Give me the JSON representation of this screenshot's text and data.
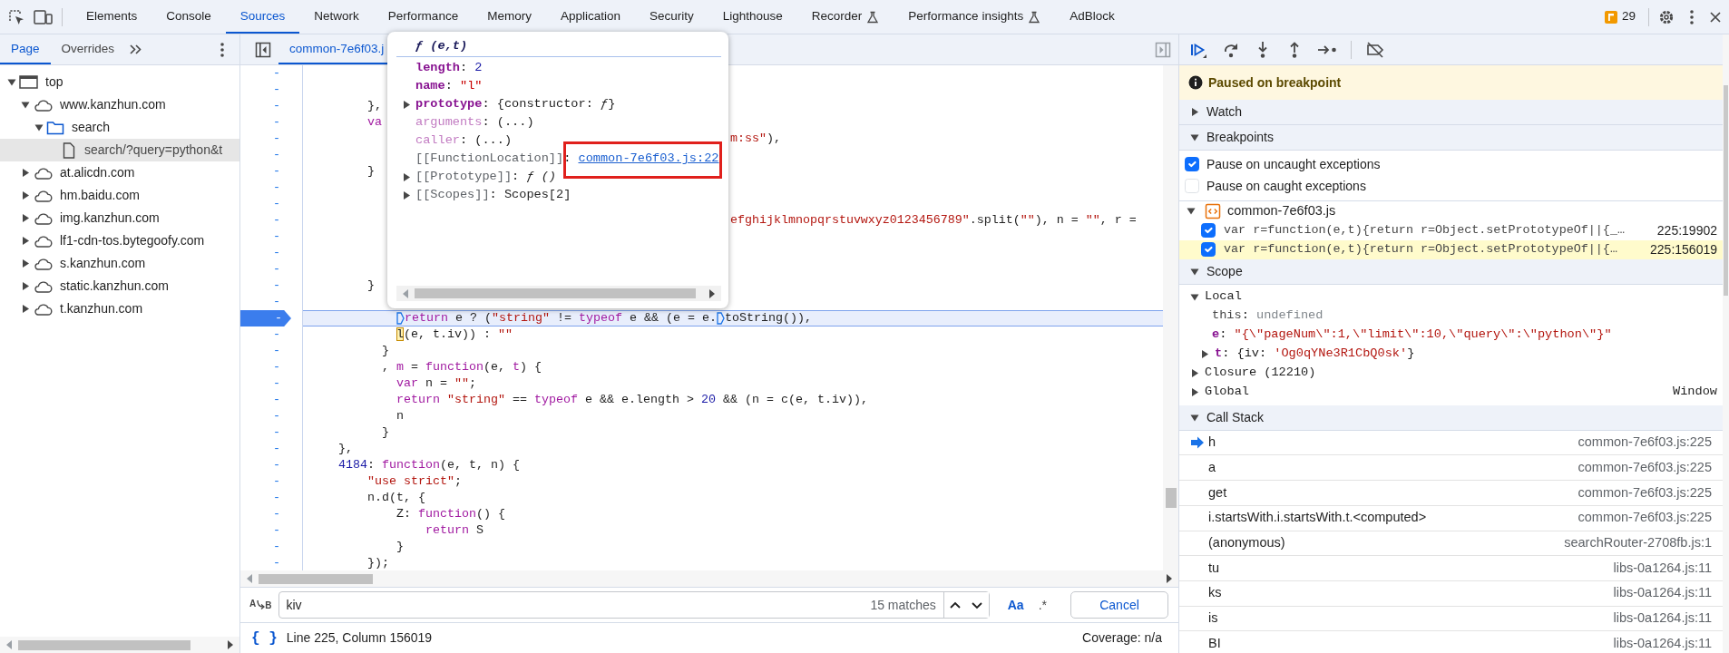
{
  "toolbar": {
    "tabs": [
      {
        "label": "Elements",
        "selected": false
      },
      {
        "label": "Console",
        "selected": false
      },
      {
        "label": "Sources",
        "selected": true
      },
      {
        "label": "Network",
        "selected": false
      },
      {
        "label": "Performance",
        "selected": false
      },
      {
        "label": "Memory",
        "selected": false
      },
      {
        "label": "Application",
        "selected": false
      },
      {
        "label": "Security",
        "selected": false
      },
      {
        "label": "Lighthouse",
        "selected": false
      },
      {
        "label": "Recorder",
        "selected": false,
        "experimental": true
      },
      {
        "label": "Performance insights",
        "selected": false,
        "experimental": true
      },
      {
        "label": "AdBlock",
        "selected": false
      }
    ],
    "issues_count": "29"
  },
  "navigator": {
    "tabs": [
      {
        "label": "Page",
        "selected": true
      },
      {
        "label": "Overrides",
        "selected": false
      }
    ],
    "tree": [
      {
        "label": "top",
        "kind": "frame",
        "expanded": true,
        "selected": false,
        "children": [
          {
            "label": "www.kanzhun.com",
            "kind": "domain",
            "expanded": true,
            "selected": false,
            "children": [
              {
                "label": "search",
                "kind": "folder",
                "expanded": true,
                "selected": false,
                "children": [
                  {
                    "label": "search/?query=python&t",
                    "kind": "file",
                    "selected": true
                  }
                ]
              }
            ]
          },
          {
            "label": "at.alicdn.com",
            "kind": "domain",
            "expanded": false,
            "selected": false
          },
          {
            "label": "hm.baidu.com",
            "kind": "domain",
            "expanded": false,
            "selected": false
          },
          {
            "label": "img.kanzhun.com",
            "kind": "domain",
            "expanded": false,
            "selected": false
          },
          {
            "label": "lf1-cdn-tos.bytegoofy.com",
            "kind": "domain",
            "expanded": false,
            "selected": false
          },
          {
            "label": "s.kanzhun.com",
            "kind": "domain",
            "expanded": false,
            "selected": false
          },
          {
            "label": "static.kanzhun.com",
            "kind": "domain",
            "expanded": false,
            "selected": false
          },
          {
            "label": "t.kanzhun.com",
            "kind": "domain",
            "expanded": false,
            "selected": false
          }
        ]
      }
    ]
  },
  "editor": {
    "tabs": [
      {
        "label": "common-7e6f03.j",
        "selected": true
      }
    ],
    "lines": [
      {
        "gutter": "-",
        "paused": false
      },
      {
        "gutter": "-",
        "paused": false
      },
      {
        "gutter": "-",
        "paused": false,
        "tokens": [
          {
            "kind": "plain",
            "text": "        },"
          }
        ]
      },
      {
        "gutter": "-",
        "paused": false,
        "tokens": [
          {
            "kind": "keyword",
            "text": "        va"
          }
        ]
      },
      {
        "gutter": "-",
        "paused": false,
        "tokens": [
          {
            "kind": "string",
            "text": "                                                          m:ss\""
          },
          {
            "kind": "plain",
            "text": "),"
          }
        ]
      },
      {
        "gutter": "-",
        "paused": false
      },
      {
        "gutter": "-",
        "paused": false,
        "tokens": [
          {
            "kind": "plain",
            "text": "        }"
          }
        ]
      },
      {
        "gutter": "-",
        "paused": false
      },
      {
        "gutter": "-",
        "paused": false
      },
      {
        "gutter": "-",
        "paused": false,
        "tokens": [
          {
            "kind": "string",
            "text": "                                                          efghijklmnopqrstuvwxyz0123456789\""
          },
          {
            "kind": "plain",
            "text": ".split("
          },
          {
            "kind": "string",
            "text": "\"\""
          },
          {
            "kind": "plain",
            "text": "), n = "
          },
          {
            "kind": "string",
            "text": "\"\""
          },
          {
            "kind": "plain",
            "text": ", r ="
          }
        ]
      },
      {
        "gutter": "-",
        "paused": false
      },
      {
        "gutter": "-",
        "paused": false
      },
      {
        "gutter": "-",
        "paused": false
      },
      {
        "gutter": "-",
        "paused": false,
        "tokens": [
          {
            "kind": "plain",
            "text": "        }"
          }
        ]
      },
      {
        "gutter": "-",
        "paused": false
      },
      {
        "gutter": "-",
        "paused": true,
        "tokens": [
          {
            "kind": "keyword",
            "text": "            return",
            "marker": true
          },
          {
            "kind": "plain",
            "text": " e ? ("
          },
          {
            "kind": "string",
            "text": "\"string\""
          },
          {
            "kind": "plain",
            "text": " != "
          },
          {
            "kind": "keyword",
            "text": "typeof"
          },
          {
            "kind": "plain",
            "text": " e && (e = e."
          },
          {
            "kind": "plain",
            "text": "toString()),",
            "marker": true
          }
        ]
      },
      {
        "gutter": "-",
        "paused": false,
        "tokens": [
          {
            "kind": "match",
            "text": "            l"
          },
          {
            "kind": "plain",
            "text": "(e, t.iv)) : "
          },
          {
            "kind": "string",
            "text": "\"\""
          }
        ]
      },
      {
        "gutter": "-",
        "paused": false,
        "tokens": [
          {
            "kind": "plain",
            "text": "          }"
          }
        ]
      },
      {
        "gutter": "-",
        "paused": false,
        "tokens": [
          {
            "kind": "plain",
            "text": "          , "
          },
          {
            "kind": "definition",
            "text": "m"
          },
          {
            "kind": "plain",
            "text": " = "
          },
          {
            "kind": "keyword",
            "text": "function"
          },
          {
            "kind": "plain",
            "text": "(e, "
          },
          {
            "kind": "definition",
            "text": "t"
          },
          {
            "kind": "plain",
            "text": ") {"
          }
        ]
      },
      {
        "gutter": "-",
        "paused": false,
        "tokens": [
          {
            "kind": "keyword",
            "text": "            var"
          },
          {
            "kind": "plain",
            "text": " n = "
          },
          {
            "kind": "string",
            "text": "\"\""
          },
          {
            "kind": "plain",
            "text": ";"
          }
        ]
      },
      {
        "gutter": "-",
        "paused": false,
        "tokens": [
          {
            "kind": "keyword",
            "text": "            return"
          },
          {
            "kind": "string",
            "text": " \"string\""
          },
          {
            "kind": "plain",
            "text": " == "
          },
          {
            "kind": "keyword",
            "text": "typeof"
          },
          {
            "kind": "plain",
            "text": " e && e.length > "
          },
          {
            "kind": "number",
            "text": "20"
          },
          {
            "kind": "plain",
            "text": " && (n = c(e, t.iv)),"
          }
        ]
      },
      {
        "gutter": "-",
        "paused": false,
        "tokens": [
          {
            "kind": "plain",
            "text": "            n"
          }
        ]
      },
      {
        "gutter": "-",
        "paused": false,
        "tokens": [
          {
            "kind": "plain",
            "text": "          }"
          }
        ]
      },
      {
        "gutter": "-",
        "paused": false,
        "tokens": [
          {
            "kind": "plain",
            "text": "    },"
          }
        ]
      },
      {
        "gutter": "-",
        "paused": false,
        "tokens": [
          {
            "kind": "number",
            "text": "    4184"
          },
          {
            "kind": "plain",
            "text": ": "
          },
          {
            "kind": "keyword",
            "text": "function"
          },
          {
            "kind": "plain",
            "text": "(e, t, n) {"
          }
        ]
      },
      {
        "gutter": "-",
        "paused": false,
        "tokens": [
          {
            "kind": "string",
            "text": "        \"use strict\""
          },
          {
            "kind": "plain",
            "text": ";"
          }
        ]
      },
      {
        "gutter": "-",
        "paused": false,
        "tokens": [
          {
            "kind": "plain",
            "text": "        n.d(t, {"
          }
        ]
      },
      {
        "gutter": "-",
        "paused": false,
        "tokens": [
          {
            "kind": "plain",
            "text": "            Z: "
          },
          {
            "kind": "keyword",
            "text": "function"
          },
          {
            "kind": "plain",
            "text": "() {"
          }
        ]
      },
      {
        "gutter": "-",
        "paused": false,
        "tokens": [
          {
            "kind": "keyword",
            "text": "                return"
          },
          {
            "kind": "plain",
            "text": " S"
          }
        ]
      },
      {
        "gutter": "-",
        "paused": false,
        "tokens": [
          {
            "kind": "plain",
            "text": "            }"
          }
        ]
      },
      {
        "gutter": "-",
        "paused": false,
        "tokens": [
          {
            "kind": "plain",
            "text": "        });"
          }
        ]
      }
    ],
    "popup": {
      "title": "ƒ (e,t)",
      "properties": [
        {
          "name": "length",
          "kind": "own",
          "expandable": false,
          "value": [
            {
              "kind": "plain",
              "text": ": "
            },
            {
              "kind": "number",
              "text": "2"
            }
          ]
        },
        {
          "name": "name",
          "kind": "own",
          "expandable": false,
          "value": [
            {
              "kind": "plain",
              "text": ": "
            },
            {
              "kind": "string",
              "text": "\"l\""
            }
          ]
        },
        {
          "name": "prototype",
          "kind": "own",
          "expandable": true,
          "value": [
            {
              "kind": "plain",
              "text": ": "
            },
            {
              "kind": "object",
              "text": "{constructor: *ƒ*}"
            }
          ]
        },
        {
          "name": "arguments",
          "kind": "accessor",
          "expandable": false,
          "value": [
            {
              "kind": "plain",
              "text": ": "
            },
            {
              "kind": "object",
              "text": "(...)"
            }
          ]
        },
        {
          "name": "caller",
          "kind": "accessor",
          "expandable": false,
          "value": [
            {
              "kind": "plain",
              "text": ": "
            },
            {
              "kind": "object",
              "text": "(...)"
            }
          ]
        },
        {
          "name": "[[FunctionLocation]]",
          "kind": "internal",
          "expandable": false,
          "value": [
            {
              "kind": "plain",
              "text": ": "
            },
            {
              "kind": "link",
              "text": "common-7e6f03.js:22",
              "annotated": true
            }
          ]
        },
        {
          "name": "[[Prototype]]",
          "kind": "internal",
          "expandable": true,
          "value": [
            {
              "kind": "plain",
              "text": ": "
            },
            {
              "kind": "object",
              "text": "*ƒ ()*"
            }
          ]
        },
        {
          "name": "[[Scopes]]",
          "kind": "internal",
          "expandable": true,
          "value": [
            {
              "kind": "plain",
              "text": ": "
            },
            {
              "kind": "object",
              "text": "Scopes[2]"
            }
          ]
        }
      ]
    },
    "search": {
      "replace_toggle": [
        "A",
        "B"
      ],
      "value": "kiv",
      "matches": "15 matches",
      "case_toggle": "Aa",
      "regex_toggle": ".*",
      "cancel": "Cancel"
    },
    "status": {
      "format_button": "{ }",
      "position": "Line 225, Column 156019",
      "coverage": "Coverage: n/a"
    }
  },
  "debugger": {
    "banner": "Paused on breakpoint",
    "watch": {
      "label": "Watch",
      "expanded": false
    },
    "breakpoints": {
      "label": "Breakpoints",
      "expanded": true,
      "options": [
        {
          "label": "Pause on uncaught exceptions",
          "checked": true
        },
        {
          "label": "Pause on caught exceptions",
          "checked": false
        }
      ],
      "files": [
        {
          "name": "common-7e6f03.js",
          "expanded": true,
          "breakpoints": [
            {
              "code": "var r=function(e,t){return r=Object.setPrototypeOf||{_…",
              "location": "225:19902",
              "checked": true,
              "hit": false
            },
            {
              "code": "var r=function(e,t){return r=Object.setPrototypeOf||{…",
              "location": "225:156019",
              "checked": true,
              "hit": true
            }
          ]
        }
      ]
    },
    "scope": {
      "label": "Scope",
      "expanded": true,
      "groups": [
        {
          "label": "Local",
          "expanded": true,
          "variables": [
            {
              "name": "this",
              "kind": "plain",
              "tokens": [
                {
                  "kind": "plain",
                  "text": ": "
                },
                {
                  "kind": "undefined",
                  "text": "undefined"
                }
              ]
            },
            {
              "name": "e",
              "kind": "own",
              "tokens": [
                {
                  "kind": "plain",
                  "text": ": "
                },
                {
                  "kind": "string",
                  "text": "\"{\\\"pageNum\\\":1,\\\"limit\\\":10,\\\"query\\\":\\\"python\\\"}\""
                }
              ]
            },
            {
              "name": "t",
              "kind": "own",
              "expanded": false,
              "tokens": [
                {
                  "kind": "plain",
                  "text": ": {iv: "
                },
                {
                  "kind": "string",
                  "text": "'Og0qYNe3R1CbQ0sk'"
                },
                {
                  "kind": "plain",
                  "text": "}"
                }
              ]
            }
          ]
        },
        {
          "label": "Closure (12210)",
          "expanded": false
        },
        {
          "label": "Global",
          "expanded": false,
          "value": "Window"
        }
      ]
    },
    "call_stack": {
      "label": "Call Stack",
      "expanded": true,
      "frames": [
        {
          "function": "h",
          "location": "common-7e6f03.js:225",
          "selected": true
        },
        {
          "function": "a",
          "location": "common-7e6f03.js:225",
          "selected": false
        },
        {
          "function": "get",
          "location": "common-7e6f03.js:225",
          "selected": false
        },
        {
          "function": "i.startsWith.i.startsWith.t.<computed>",
          "location": "common-7e6f03.js:225",
          "selected": false
        },
        {
          "function": "(anonymous)",
          "location": "searchRouter-2708fb.js:1",
          "selected": false
        },
        {
          "function": "tu",
          "location": "libs-0a1264.js:11",
          "selected": false
        },
        {
          "function": "ks",
          "location": "libs-0a1264.js:11",
          "selected": false
        },
        {
          "function": "is",
          "location": "libs-0a1264.js:11",
          "selected": false
        },
        {
          "function": "BI",
          "location": "libs-0a1264.js:11",
          "selected": false
        }
      ]
    }
  }
}
